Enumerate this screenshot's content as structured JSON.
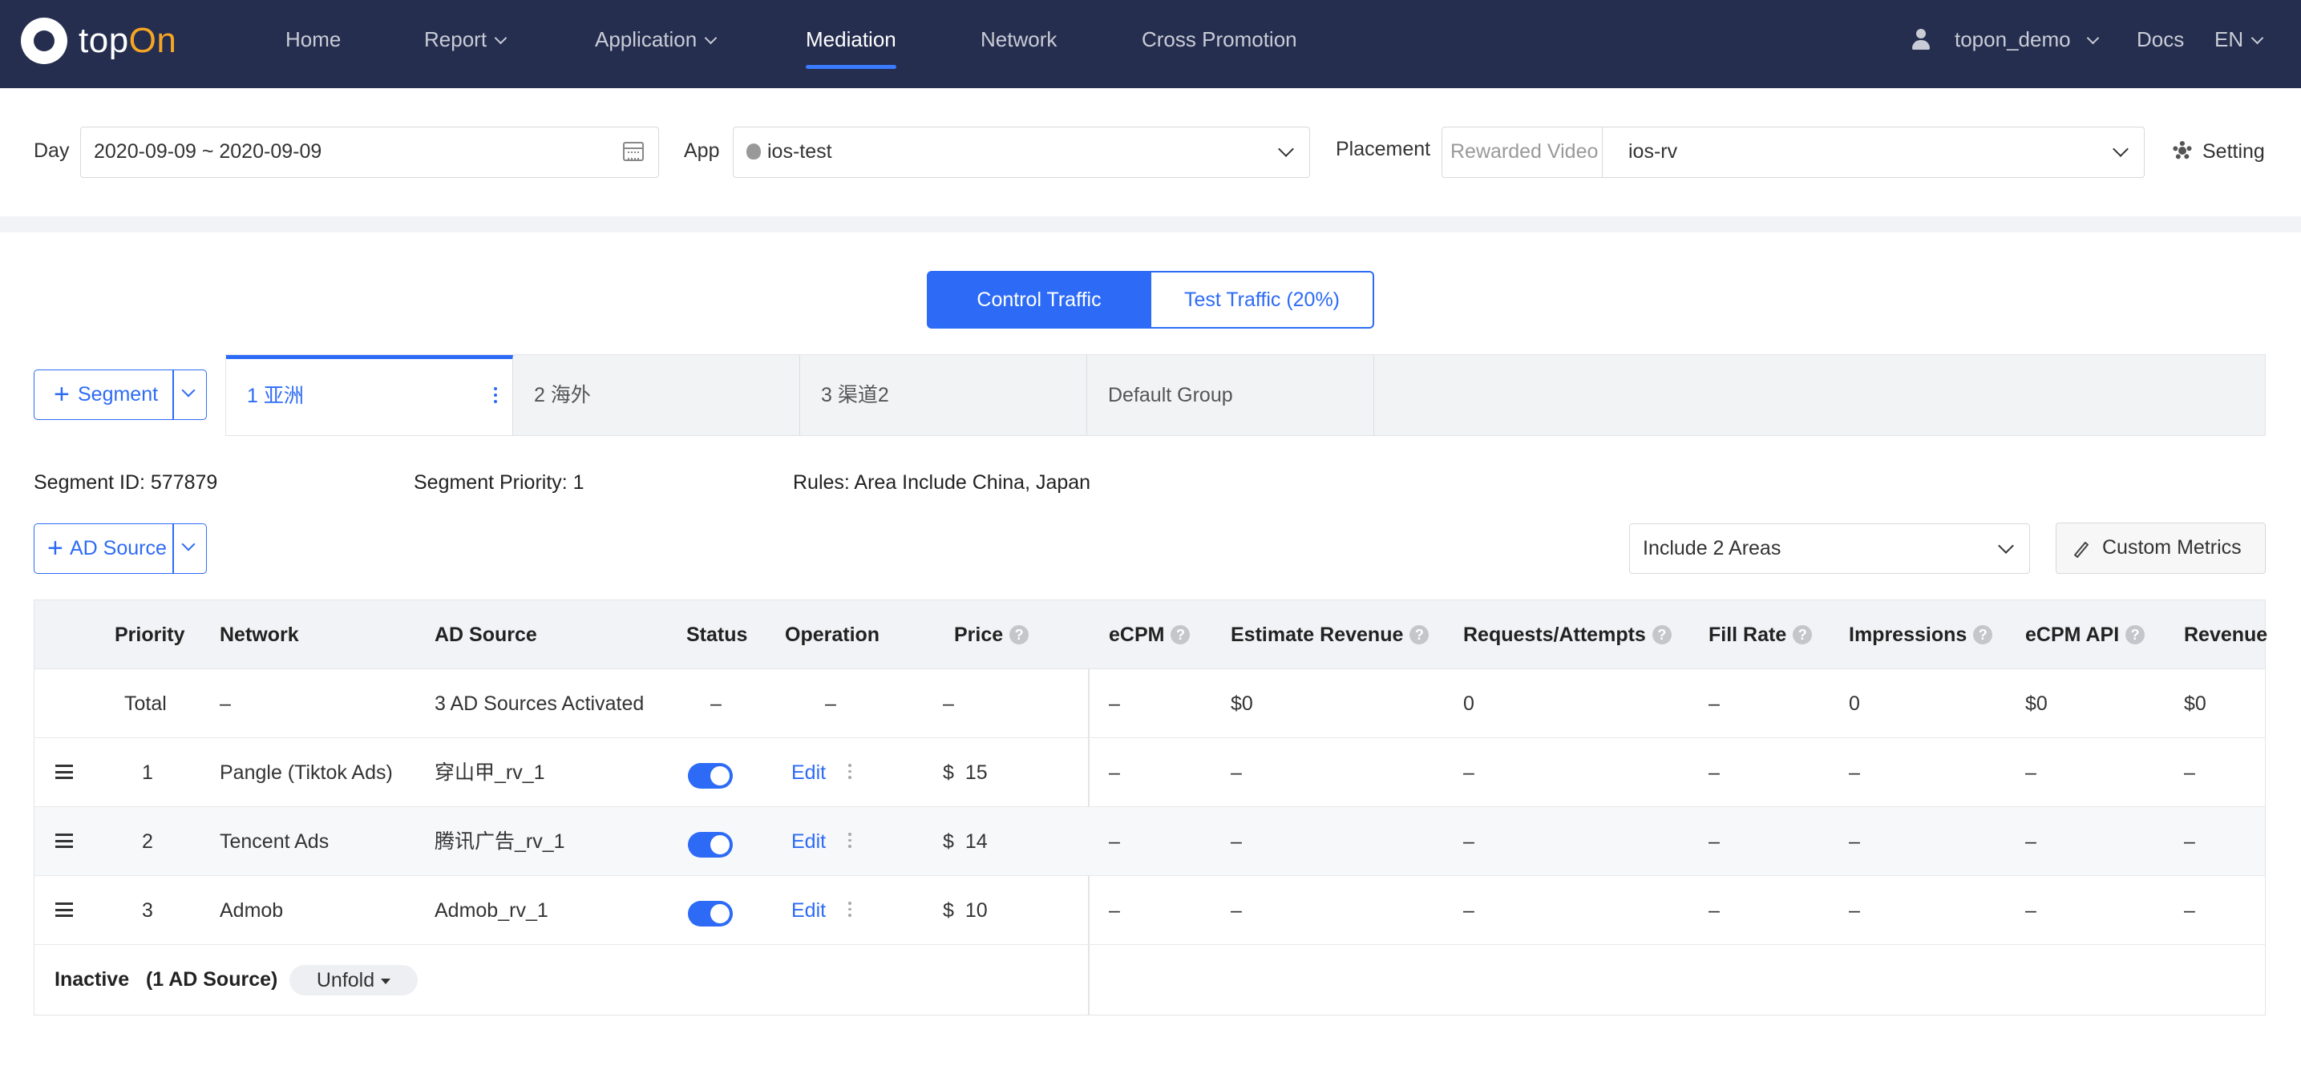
{
  "brand": {
    "logo_left": "top",
    "logo_right": "On"
  },
  "nav": {
    "home": "Home",
    "report": "Report",
    "application": "Application",
    "mediation": "Mediation",
    "network": "Network",
    "cross_promotion": "Cross Promotion",
    "user": "topon_demo",
    "docs": "Docs",
    "language": "EN"
  },
  "filters": {
    "day_label": "Day",
    "day_value": "2020-09-09 ~ 2020-09-09",
    "app_label": "App",
    "app_value": "ios-test",
    "placement_label": "Placement",
    "placement_type": "Rewarded Video",
    "placement_value": "ios-rv",
    "setting": "Setting"
  },
  "traffic": {
    "control": "Control Traffic",
    "test": "Test Traffic (20%)"
  },
  "segment_button": "Segment",
  "segment_tabs": [
    "1 亚洲",
    "2 海外",
    "3 渠道2",
    "Default Group"
  ],
  "segment_info": {
    "id": "Segment ID: 577879",
    "priority": "Segment Priority: 1",
    "rules": "Rules: Area Include China, Japan"
  },
  "ad_source_button": "AD Source",
  "areas_select": "Include 2 Areas",
  "custom_metrics": "Custom Metrics",
  "table": {
    "headers": {
      "priority": "Priority",
      "network": "Network",
      "ad_source": "AD Source",
      "status": "Status",
      "operation": "Operation",
      "price": "Price",
      "ecpm": "eCPM",
      "estimate_revenue": "Estimate Revenue",
      "requests": "Requests/Attempts",
      "fill_rate": "Fill Rate",
      "impressions": "Impressions",
      "ecpm_api": "eCPM API",
      "revenue": "Revenue"
    },
    "total": {
      "priority": "Total",
      "network": "–",
      "ad_source": "3 AD Sources Activated",
      "status": "–",
      "operation": "–",
      "price": "–",
      "ecpm": "–",
      "estimate_revenue": "$0",
      "requests": "0",
      "fill_rate": "–",
      "impressions": "0",
      "ecpm_api": "$0",
      "revenue": "$0"
    },
    "rows": [
      {
        "priority": "1",
        "network": "Pangle (Tiktok Ads)",
        "ad_source": "穿山甲_rv_1",
        "status_on": true,
        "operation": "Edit",
        "currency": "$",
        "price": "15",
        "ecpm": "–",
        "estimate_revenue": "–",
        "requests": "–",
        "fill_rate": "–",
        "impressions": "–",
        "ecpm_api": "–",
        "revenue": "–"
      },
      {
        "priority": "2",
        "network": "Tencent Ads",
        "ad_source": "腾讯广告_rv_1",
        "status_on": true,
        "operation": "Edit",
        "currency": "$",
        "price": "14",
        "ecpm": "–",
        "estimate_revenue": "–",
        "requests": "–",
        "fill_rate": "–",
        "impressions": "–",
        "ecpm_api": "–",
        "revenue": "–"
      },
      {
        "priority": "3",
        "network": "Admob",
        "ad_source": "Admob_rv_1",
        "status_on": true,
        "operation": "Edit",
        "currency": "$",
        "price": "10",
        "ecpm": "–",
        "estimate_revenue": "–",
        "requests": "–",
        "fill_rate": "–",
        "impressions": "–",
        "ecpm_api": "–",
        "revenue": "–"
      }
    ],
    "inactive": {
      "label": "Inactive",
      "count": "(1 AD Source)",
      "unfold": "Unfold"
    }
  },
  "colors": {
    "nav_bg": "#252e4f",
    "accent": "#2d6bf6",
    "logo_accent": "#f5a623"
  }
}
